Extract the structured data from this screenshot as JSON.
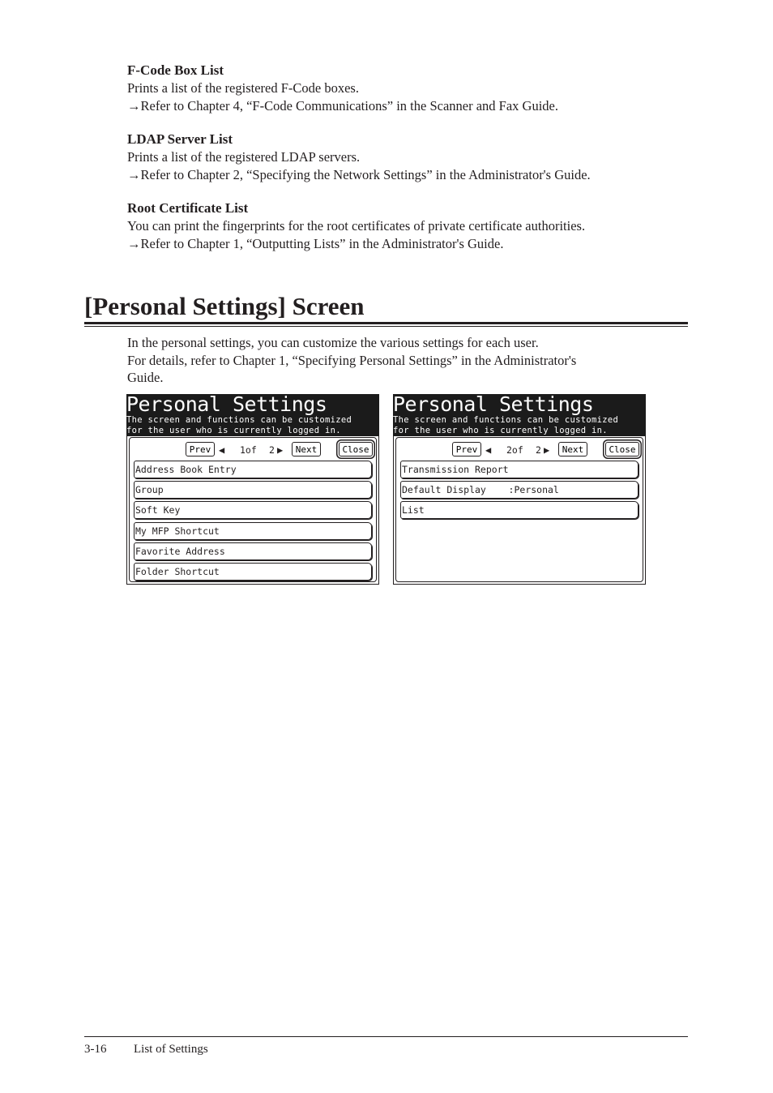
{
  "sections": [
    {
      "title": "F-Code Box List",
      "description": "Prints a list of the registered F-Code boxes.",
      "reference": "→Refer to Chapter 4, “F-Code Communications” in the Scanner and Fax Guide."
    },
    {
      "title": "LDAP Server List",
      "description": "Prints a list of the registered LDAP servers.",
      "reference": "→Refer to Chapter 2, “Specifying the Network Settings” in the Administrator's Guide."
    },
    {
      "title": "Root Certificate List",
      "description": "You can print the fingerprints for the root certificates of private certificate authorities.",
      "reference": "→Refer to Chapter 1, “Outputting Lists” in the Administrator's Guide."
    }
  ],
  "heading": "[Personal Settings] Screen",
  "intro": {
    "line1": "In the personal settings, you can customize the various settings for each user.",
    "line2": "For details, refer to Chapter 1, “Specifying Personal Settings” in the Administrator's",
    "line3": "Guide."
  },
  "screens": [
    {
      "title": "Personal Settings",
      "subtitle_line1": "The screen and functions can be customized",
      "subtitle_line2": "for the user who is currently logged in.",
      "prev_label": "Prev",
      "next_label": "Next",
      "close_label": "Close",
      "page_current": "1of",
      "page_total": "2",
      "items": [
        "Address Book Entry",
        "Group",
        "Soft Key",
        "My MFP Shortcut",
        "Favorite Address",
        "Folder Shortcut"
      ]
    },
    {
      "title": "Personal Settings",
      "subtitle_line1": "The screen and functions can be customized",
      "subtitle_line2": "for the user who is currently logged in.",
      "prev_label": "Prev",
      "next_label": "Next",
      "close_label": "Close",
      "page_current": "2of",
      "page_total": "2",
      "items": [
        "Transmission Report",
        "Default Display    :Personal",
        "List"
      ]
    }
  ],
  "footer": {
    "page_number": "3-16",
    "chapter_title": "List of Settings"
  }
}
